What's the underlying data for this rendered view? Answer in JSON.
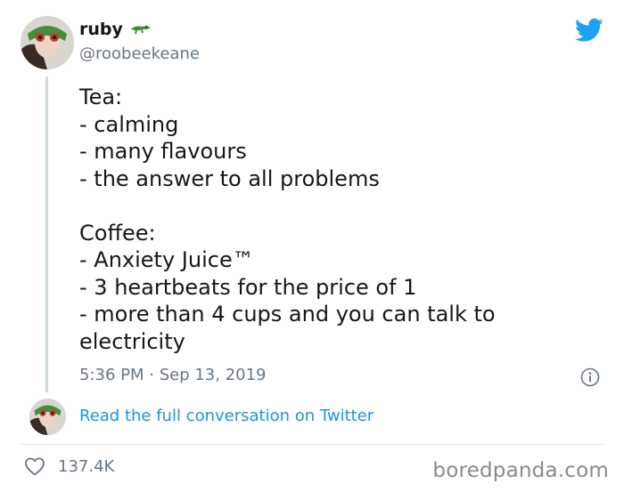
{
  "tweet": {
    "author": {
      "display_name": "ruby",
      "handle": "@roobeekeane",
      "name_emoji": "crocodile-icon"
    },
    "body_lines": [
      "Tea:",
      "- calming",
      "- many flavours",
      "- the answer to all problems",
      "",
      "Coffee:",
      "- Anxiety Juice™",
      "- 3 heartbeats for the price of 1",
      "- more than 4 cups and you can talk to electricity"
    ],
    "timestamp": "5:36 PM · Sep 13, 2019",
    "conversation_link": "Read the full conversation on Twitter",
    "like_count": "137.4K"
  },
  "icons": {
    "brand": "twitter-logo-icon",
    "info": "info-icon",
    "like": "heart-icon"
  },
  "watermark": "boredpanda.com",
  "colors": {
    "twitter_blue": "#1da1f2",
    "link_blue": "#1b95e0",
    "secondary_text": "#657786",
    "primary_text": "#14171a",
    "divider": "#e1e8ed"
  }
}
